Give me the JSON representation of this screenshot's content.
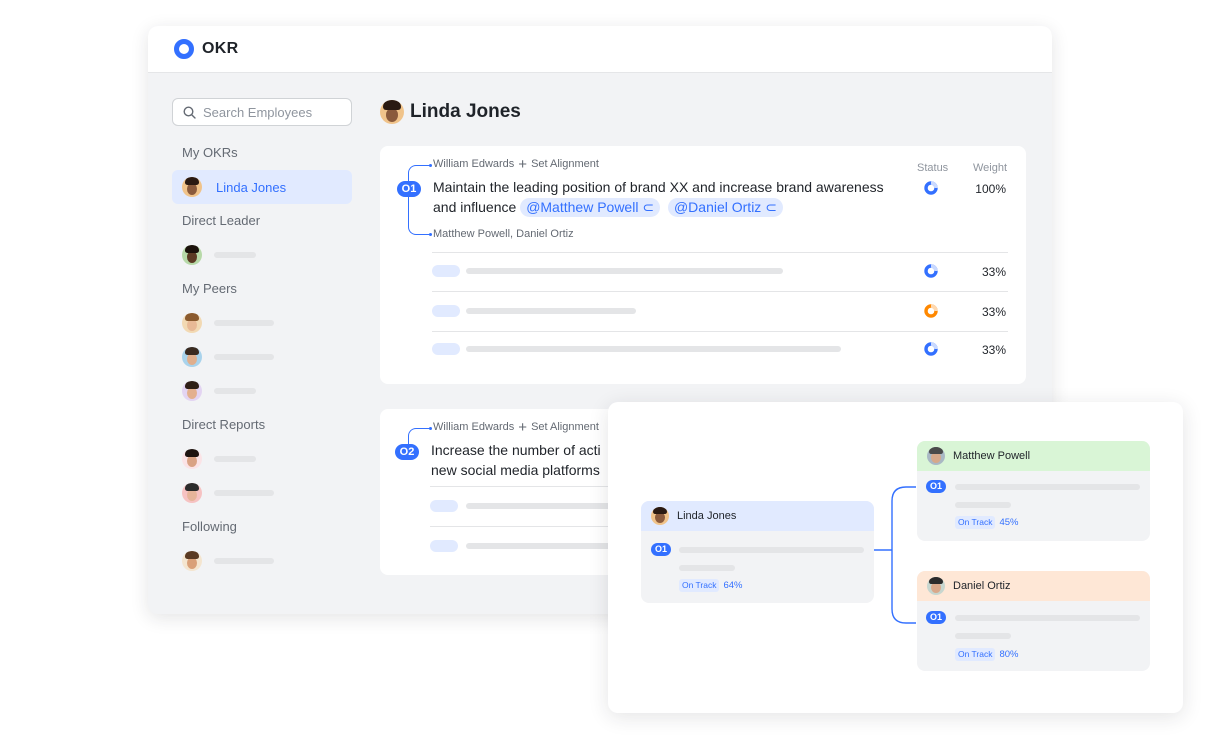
{
  "app": {
    "title": "OKR"
  },
  "search": {
    "placeholder": "Search Employees"
  },
  "sidebar": {
    "my_okrs_label": "My OKRs",
    "active_user": "Linda Jones",
    "direct_leader_label": "Direct Leader",
    "my_peers_label": "My Peers",
    "direct_reports_label": "Direct Reports",
    "following_label": "Following"
  },
  "main": {
    "title": "Linda Jones",
    "objective1": {
      "badge": "O1",
      "aligned_from": "William Edwards",
      "set_alignment": "Set Alignment",
      "text_line1": "Maintain the leading position of brand XX and increase brand awareness",
      "text_line2": "and influence",
      "mentions": [
        "@Matthew Powell",
        "@Daniel Ortiz"
      ],
      "aligned_to": "Matthew Powell, Daniel Ortiz",
      "status_label": "Status",
      "weight_label": "Weight",
      "weight": "100%",
      "key_results": [
        {
          "weight": "33%",
          "status_color": "#3370ff"
        },
        {
          "weight": "33%",
          "status_color": "#ff8800"
        },
        {
          "weight": "33%",
          "status_color": "#3370ff"
        }
      ]
    },
    "objective2": {
      "badge": "O2",
      "aligned_from": "William Edwards",
      "set_alignment": "Set Alignment",
      "text_line1": "Increase the number of acti",
      "text_line2": "new social media platforms"
    }
  },
  "alignment_map": {
    "root": {
      "name": "Linda Jones",
      "badge": "O1",
      "status": "On Track",
      "progress": "64%"
    },
    "children": [
      {
        "name": "Matthew Powell",
        "badge": "O1",
        "status": "On Track",
        "progress": "45%"
      },
      {
        "name": "Daniel Ortiz",
        "badge": "O1",
        "status": "On Track",
        "progress": "80%"
      }
    ]
  },
  "colors": {
    "accent": "#3370ff",
    "warning": "#ff8800",
    "on_track_bg": "#e1eaff"
  }
}
